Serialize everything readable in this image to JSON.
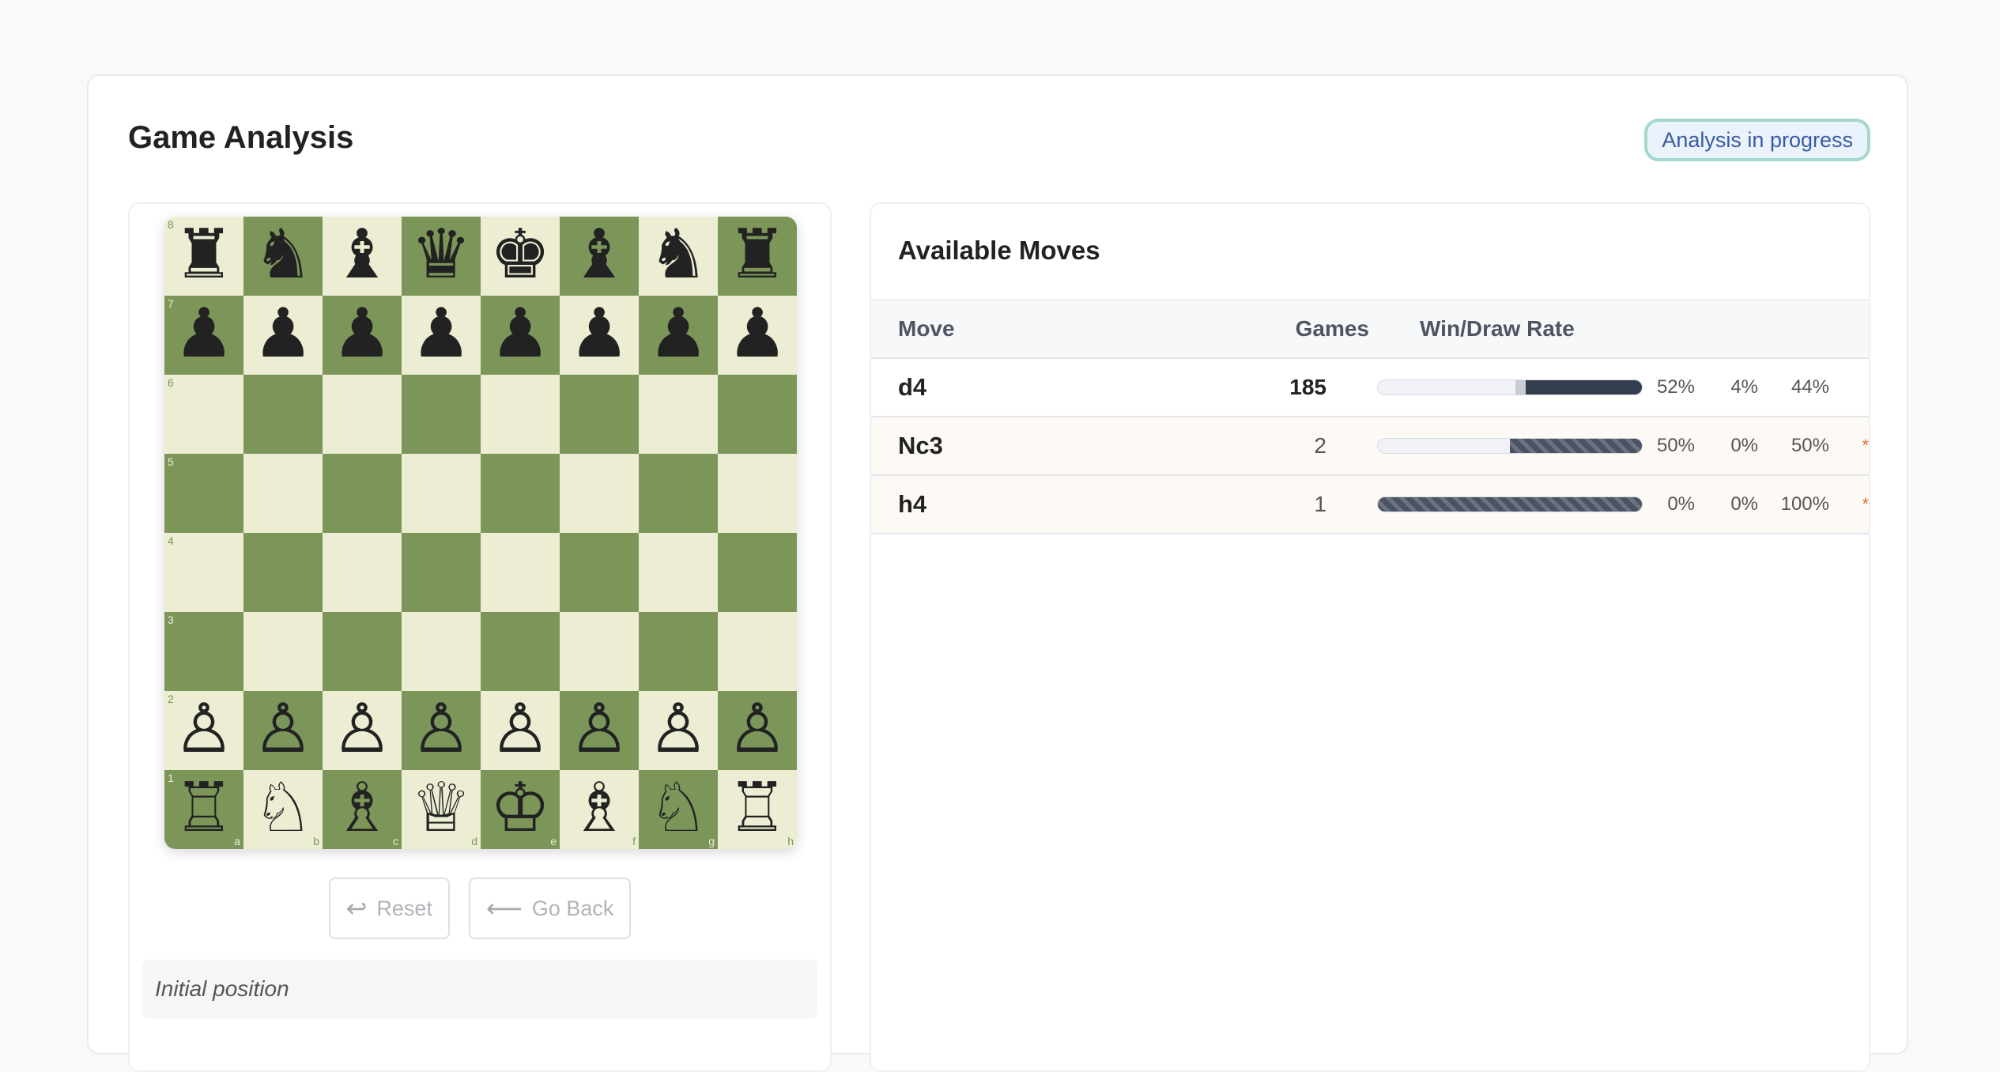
{
  "header": {
    "title": "Game Analysis",
    "status": "Analysis in progress"
  },
  "board": {
    "ranks": [
      [
        "♜",
        "♞",
        "♝",
        "♛",
        "♚",
        "♝",
        "♞",
        "♜"
      ],
      [
        "♟",
        "♟",
        "♟",
        "♟",
        "♟",
        "♟",
        "♟",
        "♟"
      ],
      [
        "",
        "",
        "",
        "",
        "",
        "",
        "",
        ""
      ],
      [
        "",
        "",
        "",
        "",
        "",
        "",
        "",
        ""
      ],
      [
        "",
        "",
        "",
        "",
        "",
        "",
        "",
        ""
      ],
      [
        "",
        "",
        "",
        "",
        "",
        "",
        "",
        ""
      ],
      [
        "♙",
        "♙",
        "♙",
        "♙",
        "♙",
        "♙",
        "♙",
        "♙"
      ],
      [
        "♖",
        "♘",
        "♗",
        "♕",
        "♔",
        "♗",
        "♘",
        "♖"
      ]
    ],
    "rank_labels": [
      "8",
      "7",
      "6",
      "5",
      "4",
      "3",
      "2",
      "1"
    ],
    "file_labels": [
      "a",
      "b",
      "c",
      "d",
      "e",
      "f",
      "g",
      "h"
    ],
    "light_color": "#ecedd3",
    "dark_color": "#7c965a"
  },
  "controls": {
    "reset_label": "Reset",
    "reset_icon": "return-arrow-icon",
    "back_label": "Go Back",
    "back_icon": "left-arrow-icon"
  },
  "position_note": "Initial position",
  "moves_panel": {
    "title": "Available Moves",
    "columns": {
      "move": "Move",
      "games": "Games",
      "rate": "Win/Draw Rate"
    },
    "rows": [
      {
        "move": "d4",
        "games": "185",
        "white": "52%",
        "draw": "4%",
        "black": "44%",
        "w": 52,
        "d": 4,
        "b": 44,
        "marker": "",
        "striped": false,
        "bold_games": true
      },
      {
        "move": "Nc3",
        "games": "2",
        "white": "50%",
        "draw": "0%",
        "black": "50%",
        "w": 50,
        "d": 0,
        "b": 50,
        "marker": "*",
        "striped": true,
        "bold_games": false
      },
      {
        "move": "h4",
        "games": "1",
        "white": "0%",
        "draw": "0%",
        "black": "100%",
        "w": 0,
        "d": 0,
        "b": 100,
        "marker": "*",
        "striped": true,
        "bold_games": false
      }
    ]
  }
}
